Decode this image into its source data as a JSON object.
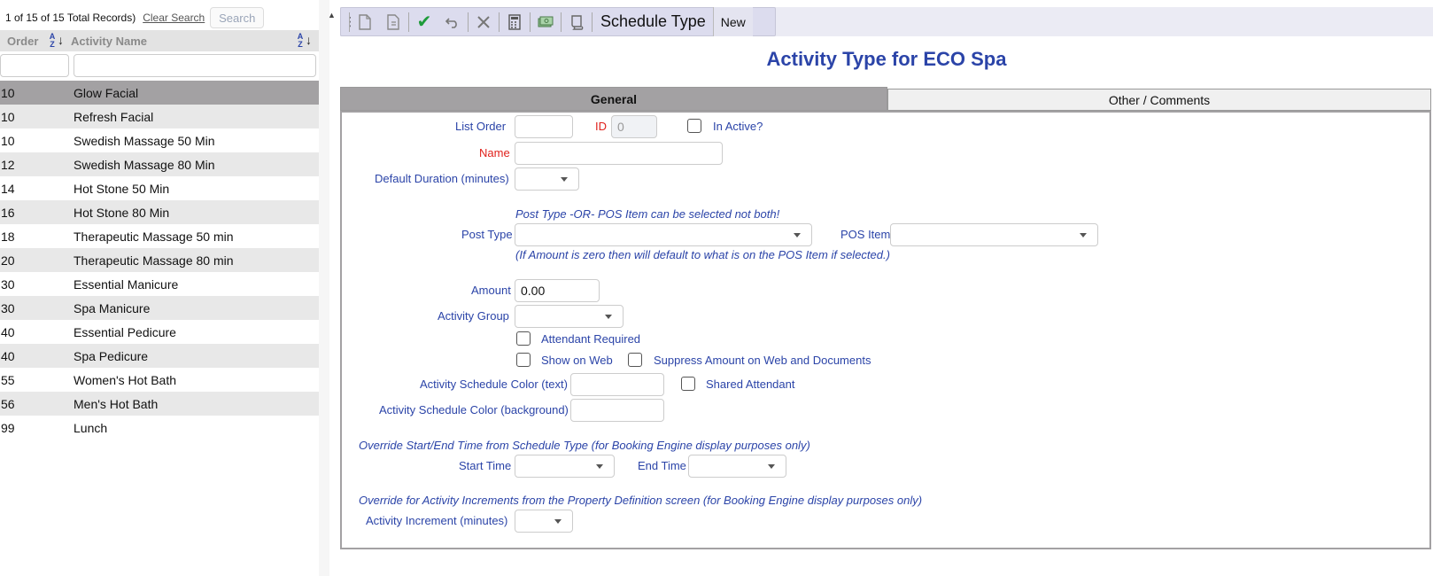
{
  "list": {
    "record_count": "1 of 15 of 15 Total Records)",
    "clear_search": "Clear Search",
    "search": "Search",
    "header_order": "Order",
    "header_name": "Activity Name",
    "rows": [
      {
        "order": "10",
        "name": "Glow Facial",
        "selected": true
      },
      {
        "order": "10",
        "name": "Refresh Facial"
      },
      {
        "order": "10",
        "name": "Swedish Massage 50 Min"
      },
      {
        "order": "12",
        "name": "Swedish Massage 80 Min"
      },
      {
        "order": "14",
        "name": "Hot Stone 50 Min"
      },
      {
        "order": "16",
        "name": "Hot Stone 80 Min"
      },
      {
        "order": "18",
        "name": "Therapeutic Massage 50 min"
      },
      {
        "order": "20",
        "name": "Therapeutic Massage 80 min"
      },
      {
        "order": "30",
        "name": "Essential Manicure"
      },
      {
        "order": "30",
        "name": "Spa Manicure"
      },
      {
        "order": "40",
        "name": "Essential Pedicure"
      },
      {
        "order": "40",
        "name": "Spa Pedicure"
      },
      {
        "order": "55",
        "name": "Women's Hot Bath"
      },
      {
        "order": "56",
        "name": "Men's Hot Bath"
      },
      {
        "order": "99",
        "name": "Lunch"
      }
    ]
  },
  "toolbar": {
    "schedule_type": "Schedule Type",
    "new": "New"
  },
  "page_title": "Activity Type for ECO Spa",
  "tabs": {
    "general": "General",
    "other": "Other / Comments"
  },
  "form": {
    "list_order_label": "List Order",
    "id_label": "ID",
    "id_value": "0",
    "inactive_label": "In Active?",
    "name_label": "Name",
    "default_duration_label": "Default Duration (minutes)",
    "post_type_note": "Post Type -OR- POS Item can be selected not both!",
    "post_type_label": "Post Type",
    "pos_item_label": "POS Item",
    "amount_note": "(If Amount is zero then will default to what is on the POS Item if selected.)",
    "amount_label": "Amount",
    "amount_value": "0.00",
    "activity_group_label": "Activity Group",
    "attendant_required_label": "Attendant Required",
    "show_on_web_label": "Show on Web",
    "suppress_amount_label": "Suppress Amount on Web and Documents",
    "color_text_label": "Activity Schedule Color (text)",
    "shared_attendant_label": "Shared Attendant",
    "color_bg_label": "Activity Schedule Color (background)",
    "override_time_note": "Override Start/End Time from Schedule Type (for Booking Engine display purposes only)",
    "start_time_label": "Start Time",
    "end_time_label": "End Time",
    "override_increment_note": "Override for Activity Increments from the Property Definition screen (for Booking Engine display purposes only)",
    "activity_increment_label": "Activity Increment (minutes)"
  },
  "colors": {
    "accent_blue": "#2b44a8",
    "required_red": "#e0211c",
    "selected_row": "#a3a1a3",
    "check_green": "#1e9b3a"
  },
  "icons": [
    "grip-icon",
    "new-document-icon",
    "copy-document-icon",
    "check-icon",
    "undo-icon",
    "delete-x-icon",
    "calculator-icon",
    "money-icon",
    "scroll-icon",
    "sort-az-icon",
    "dropdown-caret-icon"
  ]
}
